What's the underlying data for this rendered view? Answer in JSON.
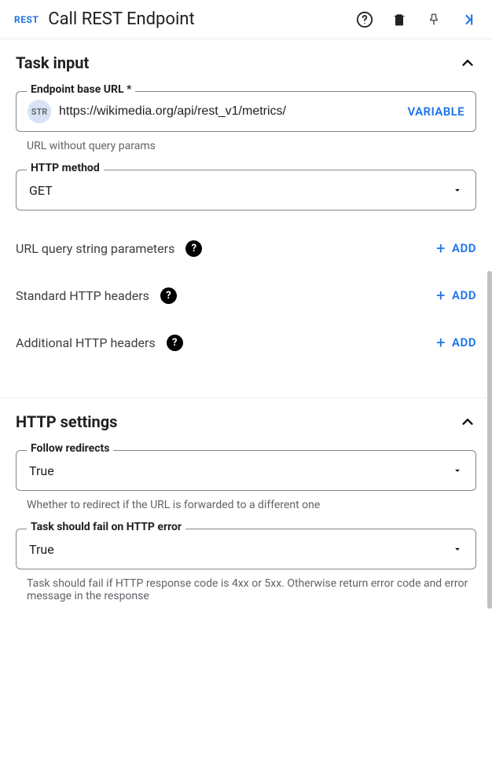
{
  "header": {
    "badge": "REST",
    "title": "Call REST Endpoint"
  },
  "sections": {
    "task_input": {
      "title": "Task input",
      "endpoint": {
        "label": "Endpoint base URL *",
        "chip": "STR",
        "value": "https://wikimedia.org/api/rest_v1/metrics/",
        "variable_label": "VARIABLE",
        "hint": "URL without query params"
      },
      "http_method": {
        "label": "HTTP method",
        "value": "GET"
      },
      "rows": {
        "query_params": {
          "label": "URL query string parameters",
          "add": "ADD"
        },
        "std_headers": {
          "label": "Standard HTTP headers",
          "add": "ADD"
        },
        "addl_headers": {
          "label": "Additional HTTP headers",
          "add": "ADD"
        }
      }
    },
    "http_settings": {
      "title": "HTTP settings",
      "follow_redirects": {
        "label": "Follow redirects",
        "value": "True",
        "hint": "Whether to redirect if the URL is forwarded to a different one"
      },
      "fail_on_error": {
        "label": "Task should fail on HTTP error",
        "value": "True",
        "hint": "Task should fail if HTTP response code is 4xx or 5xx. Otherwise return error code and error message in the response"
      }
    }
  },
  "misc": {
    "help_glyph": "?",
    "plus_glyph": "+"
  }
}
